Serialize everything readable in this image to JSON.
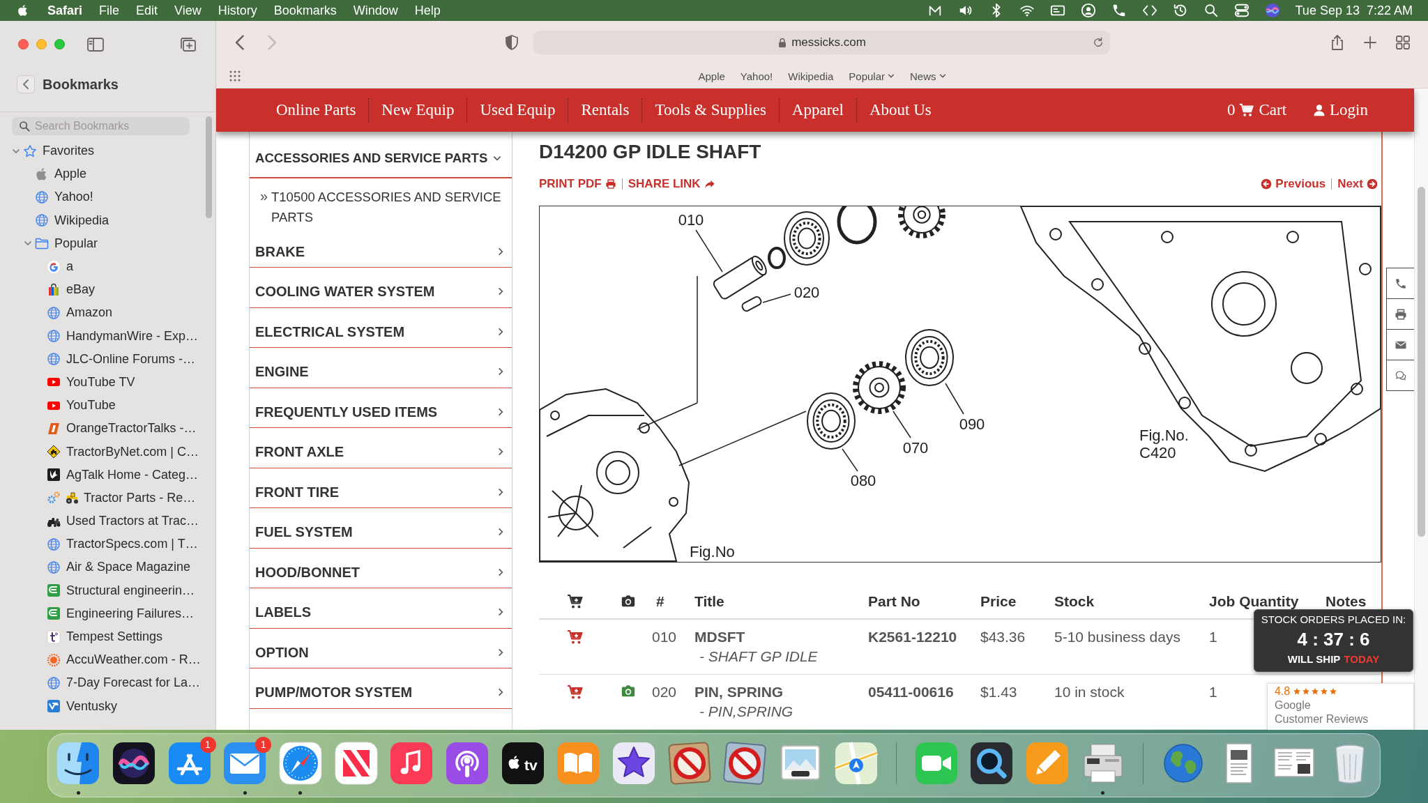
{
  "menu_bar": {
    "app_name": "Safari",
    "menus": [
      "File",
      "Edit",
      "View",
      "History",
      "Bookmarks",
      "Window",
      "Help"
    ],
    "clock": "Tue Sep 13  7:22 AM"
  },
  "toolbar": {
    "nav_buttons": [
      {
        "kind": "back",
        "disabled": false
      },
      {
        "kind": "forward",
        "disabled": true
      }
    ],
    "address": "messicks.com",
    "favorites": [
      {
        "label": "Apple",
        "menu": false
      },
      {
        "label": "Yahoo!",
        "menu": false
      },
      {
        "label": "Wikipedia",
        "menu": false
      },
      {
        "label": "Popular",
        "menu": true
      },
      {
        "label": "News",
        "menu": true
      }
    ]
  },
  "sidebar": {
    "title": "Bookmarks",
    "search": {
      "placeholder": "Search Bookmarks"
    },
    "items": [
      {
        "label": "Favorites",
        "kind": "star",
        "expanded": true,
        "children": [
          {
            "label": "Apple",
            "kind": "apple"
          },
          {
            "label": "Yahoo!",
            "kind": "globe"
          },
          {
            "label": "Wikipedia",
            "kind": "globe"
          },
          {
            "label": "Popular",
            "kind": "folder",
            "expanded": true,
            "children": [
              {
                "label": "a",
                "kind": "g_logo"
              },
              {
                "label": "eBay",
                "kind": "bag"
              },
              {
                "label": "Amazon",
                "kind": "globe"
              },
              {
                "label": "HandymanWire - Exp…",
                "kind": "globe"
              },
              {
                "label": "JLC-Online Forums -…",
                "kind": "globe"
              },
              {
                "label": "YouTube TV",
                "kind": "play"
              },
              {
                "label": "YouTube",
                "kind": "play"
              },
              {
                "label": "OrangeTractorTalks -…",
                "kind": "slant_tile"
              },
              {
                "label": "TractorByNet.com | C…",
                "kind": "diamond_sign"
              },
              {
                "label": "AgTalk Home - Categ…",
                "kind": "wing_tile"
              },
              {
                "label": "Tractor Parts - Re…",
                "kind": "gears_tractor"
              },
              {
                "label": "Used Tractors at Trac…",
                "kind": "tractors"
              },
              {
                "label": "TractorSpecs.com | T…",
                "kind": "globe"
              },
              {
                "label": "Air & Space Magazine",
                "kind": "globe"
              },
              {
                "label": "Structural engineerin…",
                "kind": "swoosh_tile"
              },
              {
                "label": "Engineering Failures…",
                "kind": "swoosh_tile"
              },
              {
                "label": "Tempest Settings",
                "kind": "mark_tile"
              },
              {
                "label": "AccuWeather.com - R…",
                "kind": "sun"
              },
              {
                "label": "7-Day Forecast for La…",
                "kind": "globe"
              },
              {
                "label": "Ventusky",
                "kind": "wave_tile"
              }
            ]
          }
        ]
      }
    ]
  },
  "site": {
    "nav": [
      "Online Parts",
      "New Equip",
      "Used Equip",
      "Rentals",
      "Tools & Supplies",
      "Apparel",
      "About Us"
    ],
    "cart": {
      "count": "0",
      "label": "Cart"
    },
    "login": "Login",
    "category_menu": {
      "heading": "ACCESSORIES AND SERVICE PARTS",
      "expanded": true,
      "subcategories": [
        "T10500 ACCESSORIES AND SERVICE PARTS"
      ],
      "categories": [
        "BRAKE",
        "COOLING WATER SYSTEM",
        "ELECTRICAL SYSTEM",
        "ENGINE",
        "FREQUENTLY USED ITEMS",
        "FRONT AXLE",
        "FRONT TIRE",
        "FUEL SYSTEM",
        "HOOD/BONNET",
        "LABELS",
        "OPTION",
        "PUMP/MOTOR SYSTEM"
      ]
    },
    "title": "D14200 GP IDLE SHAFT",
    "links": {
      "print": "PRINT PDF",
      "share": "SHARE LINK",
      "previous": "Previous",
      "next": "Next"
    },
    "diagram": {
      "callouts": [
        "010",
        "020",
        "090",
        "070",
        "080"
      ],
      "figure_labels": [
        "Fig.No.",
        "C420",
        "Fig.No"
      ]
    },
    "table": {
      "columns": [
        "#",
        "Title",
        "Part No",
        "Price",
        "Stock",
        "Job Quantity",
        "Notes"
      ],
      "rows": [
        {
          "number": "010",
          "title": "MDSFT",
          "description": "- SHAFT GP IDLE",
          "part_no": "K2561-12210",
          "price": "$43.36",
          "stock": "5-10 business days",
          "quantity": "1",
          "has_photo": false
        },
        {
          "number": "020",
          "title": "PIN, SPRING",
          "description": "- PIN,SPRING",
          "part_no": "05411-00616",
          "price": "$1.43",
          "stock": "10 in stock",
          "quantity": "1",
          "has_photo": true
        }
      ]
    },
    "stock_timer": {
      "heading": "STOCK ORDERS PLACED IN:",
      "countdown": "4 : 37 : 6",
      "ship_label": "WILL SHIP",
      "ship_day": "TODAY"
    },
    "reviews": {
      "rating": "4.8",
      "stars": 5,
      "source": "Google",
      "caption": "Customer Reviews"
    }
  },
  "dock": {
    "groups": [
      [
        {
          "kind": "smile_tile",
          "running": true
        },
        {
          "kind": "orb",
          "running": false
        },
        {
          "kind": "a_tile",
          "running": false,
          "badge": "1"
        },
        {
          "kind": "envelope",
          "running": true,
          "badge": "1"
        },
        {
          "kind": "compass",
          "running": true
        },
        {
          "kind": "n_tile",
          "running": false
        },
        {
          "kind": "note",
          "running": false
        },
        {
          "kind": "mic",
          "running": false
        },
        {
          "kind": "tv",
          "running": false,
          "text": "tv"
        },
        {
          "kind": "book",
          "running": false
        },
        {
          "kind": "star",
          "running": false
        },
        {
          "kind": "prohibited",
          "running": false
        },
        {
          "kind": "prohibited_alt",
          "running": false
        },
        {
          "kind": "photo",
          "running": false
        },
        {
          "kind": "map",
          "running": false
        }
      ],
      [
        {
          "kind": "camera",
          "running": false
        },
        {
          "kind": "lens",
          "running": false
        },
        {
          "kind": "pencil",
          "running": false
        },
        {
          "kind": "printer",
          "running": true
        }
      ],
      [
        {
          "kind": "globe",
          "running": false
        },
        {
          "kind": "document",
          "running": false
        },
        {
          "kind": "document_wide",
          "running": false
        },
        {
          "kind": "trash",
          "running": false
        }
      ]
    ]
  }
}
